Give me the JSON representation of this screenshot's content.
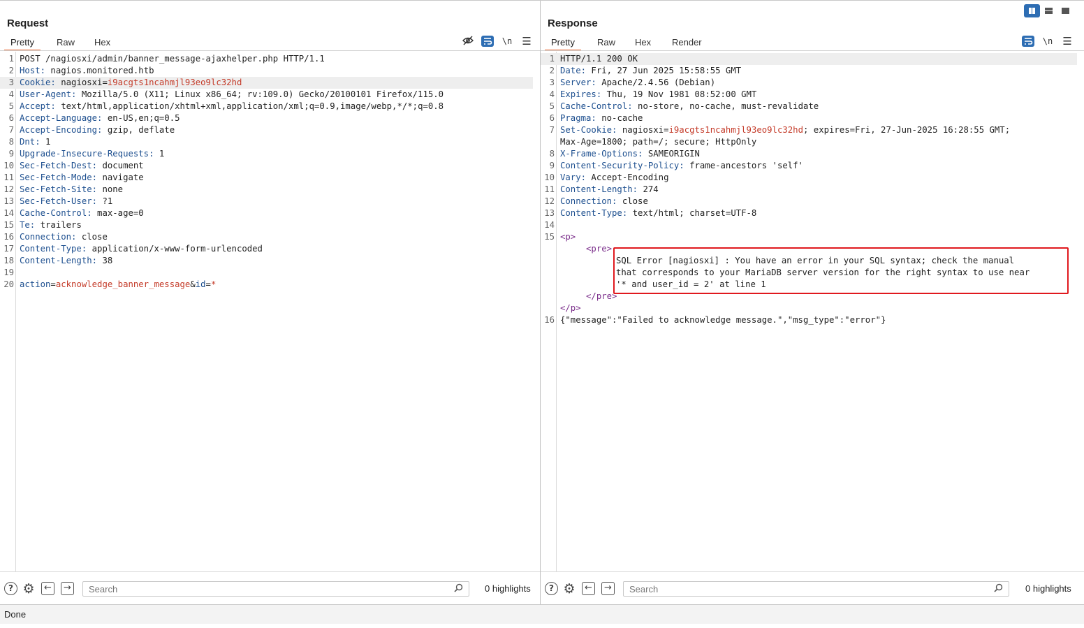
{
  "request": {
    "title": "Request",
    "tabs": [
      "Pretty",
      "Raw",
      "Hex"
    ],
    "active_tab": "Pretty",
    "toolbar_newline": "\\n",
    "lines": [
      {
        "n": "1",
        "name": "",
        "value": "POST /nagiosxi/admin/banner_message-ajaxhelper.php HTTP/1.1"
      },
      {
        "n": "2",
        "name": "Host:",
        "value": " nagios.monitored.htb"
      },
      {
        "n": "3",
        "name": "Cookie:",
        "value": " nagiosxi=",
        "cookie": "i9acgts1ncahmjl93eo9lc32hd"
      },
      {
        "n": "4",
        "name": "User-Agent:",
        "value": " Mozilla/5.0 (X11; Linux x86_64; rv:109.0) Gecko/20100101 Firefox/115.0"
      },
      {
        "n": "5",
        "name": "Accept:",
        "value": " text/html,application/xhtml+xml,application/xml;q=0.9,image/webp,*/*;q=0.8"
      },
      {
        "n": "6",
        "name": "Accept-Language:",
        "value": " en-US,en;q=0.5"
      },
      {
        "n": "7",
        "name": "Accept-Encoding:",
        "value": " gzip, deflate"
      },
      {
        "n": "8",
        "name": "Dnt:",
        "value": " 1"
      },
      {
        "n": "9",
        "name": "Upgrade-Insecure-Requests:",
        "value": " 1"
      },
      {
        "n": "10",
        "name": "Sec-Fetch-Dest:",
        "value": " document"
      },
      {
        "n": "11",
        "name": "Sec-Fetch-Mode:",
        "value": " navigate"
      },
      {
        "n": "12",
        "name": "Sec-Fetch-Site:",
        "value": " none"
      },
      {
        "n": "13",
        "name": "Sec-Fetch-User:",
        "value": " ?1"
      },
      {
        "n": "14",
        "name": "Cache-Control:",
        "value": " max-age=0"
      },
      {
        "n": "15",
        "name": "Te:",
        "value": " trailers"
      },
      {
        "n": "16",
        "name": "Connection:",
        "value": " close"
      },
      {
        "n": "17",
        "name": "Content-Type:",
        "value": " application/x-www-form-urlencoded"
      },
      {
        "n": "18",
        "name": "Content-Length:",
        "value": " 38"
      },
      {
        "n": "19",
        "name": "",
        "value": ""
      },
      {
        "n": "20",
        "body": true,
        "p1": "action",
        "p1v": "acknowledge_banner_message",
        "p2": "id",
        "p2v": "*"
      }
    ],
    "search_placeholder": "Search",
    "highlights": "0 highlights"
  },
  "response": {
    "title": "Response",
    "tabs": [
      "Pretty",
      "Raw",
      "Hex",
      "Render"
    ],
    "active_tab": "Pretty",
    "toolbar_newline": "\\n",
    "headers": [
      {
        "n": "1",
        "name": "",
        "value": "HTTP/1.1 200 OK"
      },
      {
        "n": "2",
        "name": "Date:",
        "value": " Fri, 27 Jun 2025 15:58:55 GMT"
      },
      {
        "n": "3",
        "name": "Server:",
        "value": " Apache/2.4.56 (Debian)"
      },
      {
        "n": "4",
        "name": "Expires:",
        "value": " Thu, 19 Nov 1981 08:52:00 GMT"
      },
      {
        "n": "5",
        "name": "Cache-Control:",
        "value": " no-store, no-cache, must-revalidate"
      },
      {
        "n": "6",
        "name": "Pragma:",
        "value": " no-cache"
      },
      {
        "n": "7",
        "name": "Set-Cookie:",
        "value": " nagiosxi=",
        "cookie": "i9acgts1ncahmjl93eo9lc32hd",
        "tail": "; expires=Fri, 27-Jun-2025 16:28:55 GMT;",
        "cont": "Max-Age=1800; path=/; secure; HttpOnly"
      },
      {
        "n": "8",
        "name": "X-Frame-Options:",
        "value": " SAMEORIGIN"
      },
      {
        "n": "9",
        "name": "Content-Security-Policy:",
        "value": " frame-ancestors 'self'"
      },
      {
        "n": "10",
        "name": "Vary:",
        "value": " Accept-Encoding"
      },
      {
        "n": "11",
        "name": "Content-Length:",
        "value": " 274"
      },
      {
        "n": "12",
        "name": "Connection:",
        "value": " close"
      },
      {
        "n": "13",
        "name": "Content-Type:",
        "value": " text/html; charset=UTF-8"
      },
      {
        "n": "14",
        "name": "",
        "value": ""
      }
    ],
    "body": {
      "line15_num": "15",
      "p_open": "<p>",
      "pre_open": "<pre>",
      "error_lines": [
        "SQL Error [nagiosxi] : You have an error in your SQL syntax; check the manual",
        "that corresponds to your MariaDB server version for the right syntax to use near",
        "'* and user_id = 2' at line 1"
      ],
      "pre_close": "</pre>",
      "p_close": "</p>",
      "line16_num": "16",
      "json_line": "{\"message\":\"Failed to acknowledge message.\",\"msg_type\":\"error\"}"
    },
    "search_placeholder": "Search",
    "highlights": "0 highlights"
  },
  "status": "Done",
  "colors": {
    "accent_tab": "#e9703d",
    "header_name": "#1d4f8f",
    "cookie_value": "#c43a28",
    "html_tag": "#7a2d8a",
    "highlight_box": "#e0191e",
    "active_toggle": "#2d6db3"
  }
}
